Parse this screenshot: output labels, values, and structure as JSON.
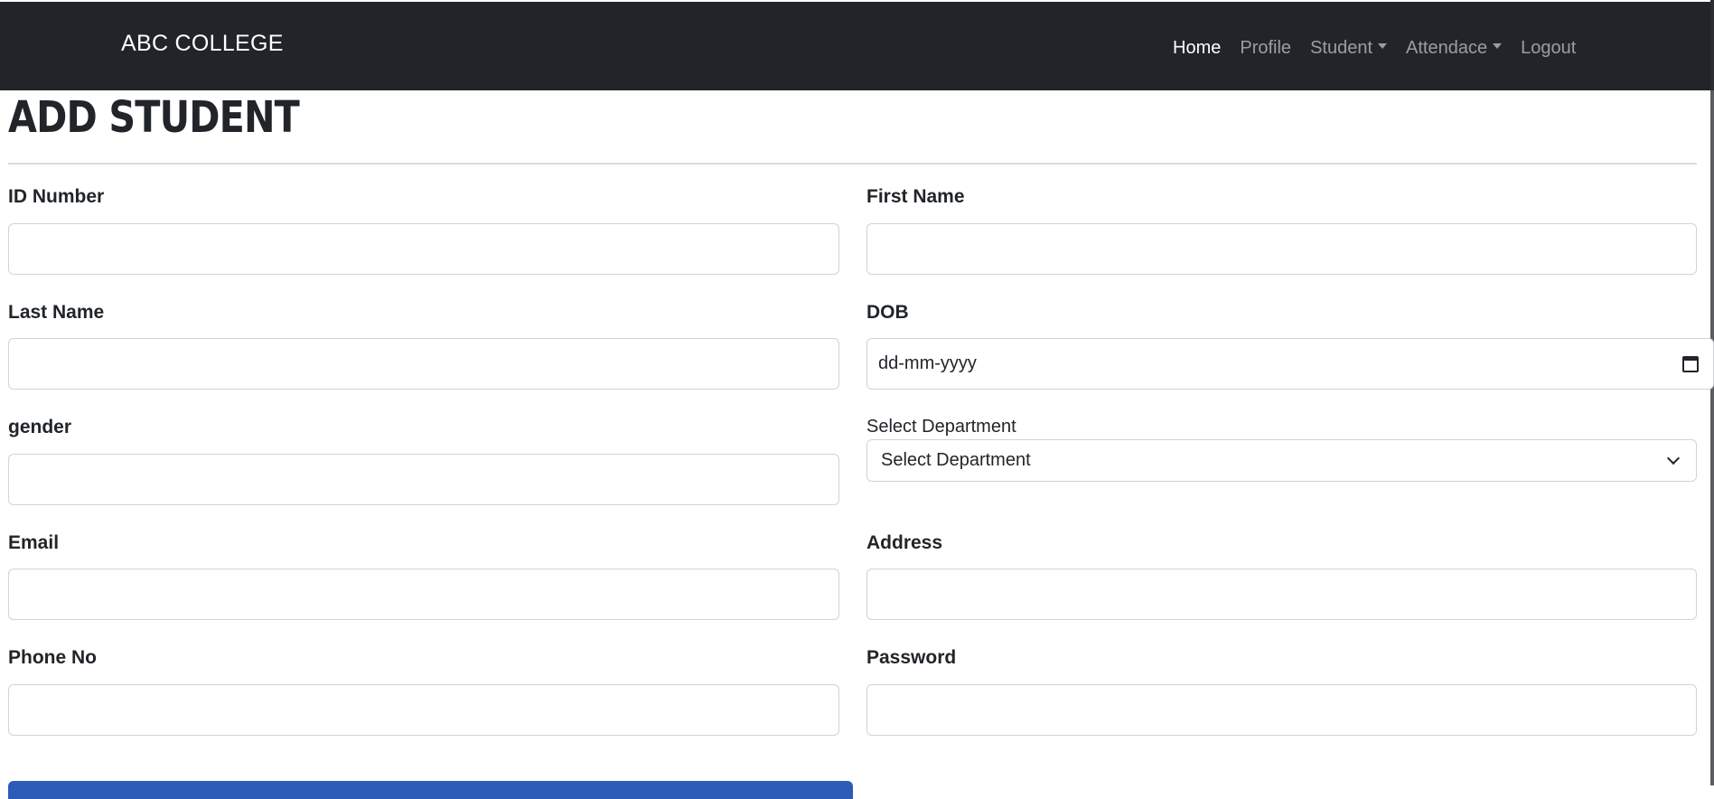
{
  "navbar": {
    "brand": "ABC COLLEGE",
    "links": [
      {
        "label": "Home",
        "active": true,
        "dropdown": false
      },
      {
        "label": "Profile",
        "active": false,
        "dropdown": false
      },
      {
        "label": "Student",
        "active": false,
        "dropdown": true
      },
      {
        "label": "Attendace",
        "active": false,
        "dropdown": true
      },
      {
        "label": "Logout",
        "active": false,
        "dropdown": false
      }
    ]
  },
  "page": {
    "title": "ADD STUDENT"
  },
  "form": {
    "id_number": {
      "label": "ID Number",
      "value": ""
    },
    "first_name": {
      "label": "First Name",
      "value": ""
    },
    "last_name": {
      "label": "Last Name",
      "value": ""
    },
    "dob": {
      "label": "DOB",
      "placeholder": "dd-mm-yyyy"
    },
    "gender": {
      "label": "gender",
      "value": ""
    },
    "department": {
      "label": "Select Department",
      "selected": "Select Department"
    },
    "email": {
      "label": "Email",
      "value": ""
    },
    "address": {
      "label": "Address",
      "value": ""
    },
    "phone": {
      "label": "Phone No",
      "value": ""
    },
    "password": {
      "label": "Password",
      "value": ""
    }
  },
  "colors": {
    "navbar_bg": "#212529",
    "submit_button": "#2d5bb8"
  }
}
